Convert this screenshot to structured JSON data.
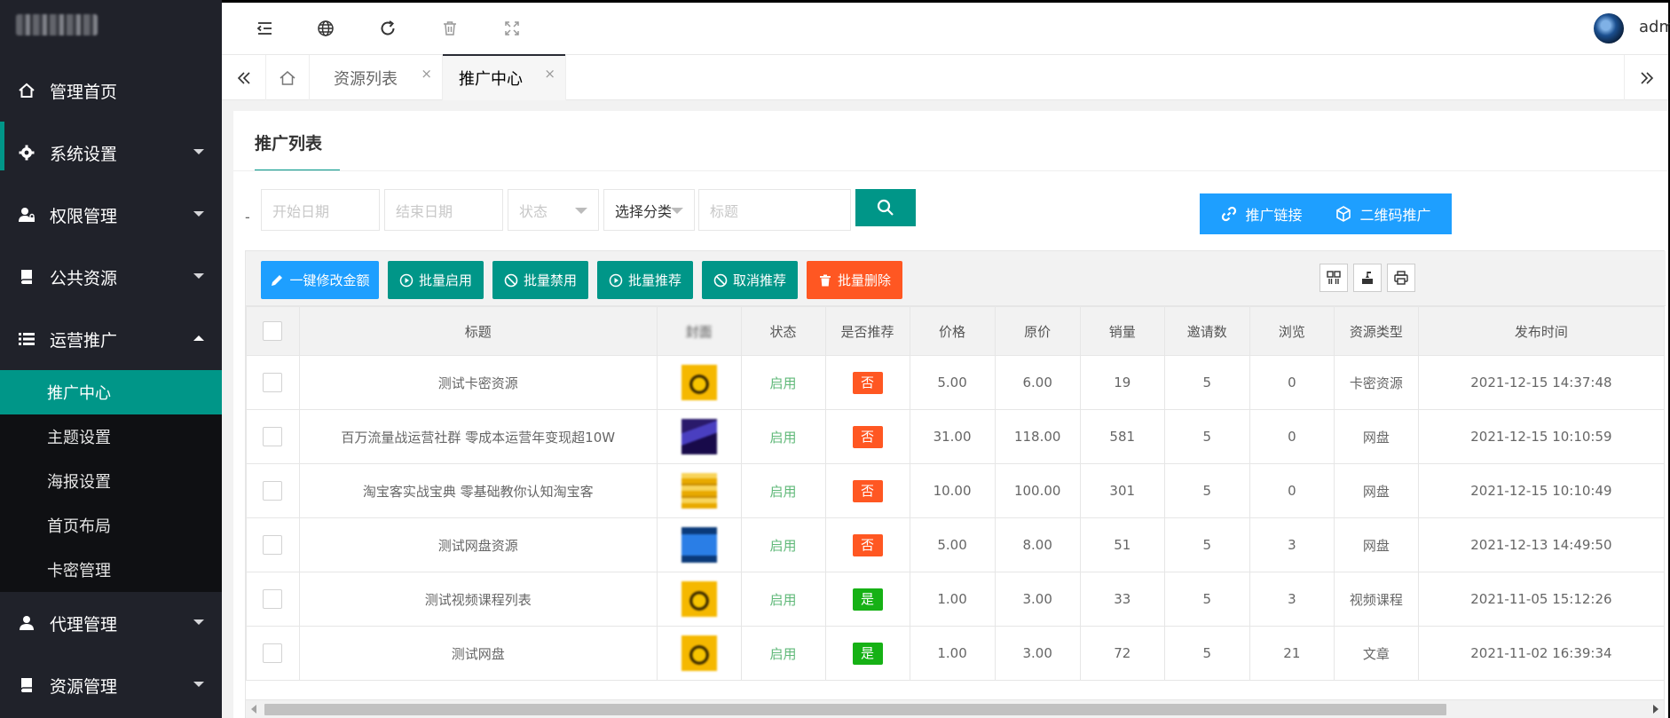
{
  "sidebar": {
    "menu": [
      {
        "label": "管理首页",
        "icon": "home-icon",
        "caret": "none"
      },
      {
        "label": "系统设置",
        "icon": "gear-icon",
        "caret": "down"
      },
      {
        "label": "权限管理",
        "icon": "user-lock-icon",
        "caret": "down"
      },
      {
        "label": "公共资源",
        "icon": "book-icon",
        "caret": "down"
      },
      {
        "label": "运营推广",
        "icon": "list-icon",
        "caret": "up"
      }
    ],
    "sub_items": [
      "推广中心",
      "主题设置",
      "海报设置",
      "首页布局",
      "卡密管理"
    ],
    "menu_after": [
      {
        "label": "代理管理",
        "icon": "user-icon",
        "caret": "down"
      },
      {
        "label": "资源管理",
        "icon": "book-icon",
        "caret": "down"
      }
    ]
  },
  "header": {
    "tools": [
      "menu-fold-icon",
      "globe-icon",
      "refresh-icon",
      "trash-icon",
      "fullscreen-icon"
    ],
    "user_name": "adm"
  },
  "tabs": {
    "items": [
      {
        "label": "资源列表",
        "close": "×"
      },
      {
        "label": "推广中心",
        "close": "×"
      }
    ]
  },
  "panel": {
    "title": "推广列表",
    "filters": {
      "dash": "-",
      "start_date": "开始日期",
      "end_date": "结束日期",
      "status": "状态",
      "category": "选择分类",
      "title": "标题"
    },
    "promo_link": "推广链接",
    "qr_promo": "二维码推广"
  },
  "actions": {
    "edit_amount": "一键修改金额",
    "batch_enable": "批量启用",
    "batch_disable": "批量禁用",
    "batch_recommend": "批量推荐",
    "cancel_recommend": "取消推荐",
    "batch_delete": "批量删除"
  },
  "table": {
    "columns": [
      "标题",
      "封面",
      "状态",
      "是否推荐",
      "价格",
      "原价",
      "销量",
      "邀请数",
      "浏览",
      "资源类型",
      "发布时间"
    ],
    "rows": [
      {
        "title": "测试卡密资源",
        "cover": "c-yellow",
        "status": "启用",
        "recommend": "否",
        "price": "5.00",
        "original": "6.00",
        "sales": "19",
        "invites": "5",
        "views": "0",
        "type": "卡密资源",
        "time": "2021-12-15 14:37:48"
      },
      {
        "title": "百万流量战运营社群 零成本运营年变现超10W",
        "cover": "c-purple",
        "status": "启用",
        "recommend": "否",
        "price": "31.00",
        "original": "118.00",
        "sales": "581",
        "invites": "5",
        "views": "0",
        "type": "网盘",
        "time": "2021-12-15 10:10:59"
      },
      {
        "title": "淘宝客实战宝典 零基础教你认知淘宝客",
        "cover": "c-gold",
        "status": "启用",
        "recommend": "否",
        "price": "10.00",
        "original": "100.00",
        "sales": "301",
        "invites": "5",
        "views": "0",
        "type": "网盘",
        "time": "2021-12-15 10:10:49"
      },
      {
        "title": "测试网盘资源",
        "cover": "c-blue",
        "status": "启用",
        "recommend": "否",
        "price": "5.00",
        "original": "8.00",
        "sales": "51",
        "invites": "5",
        "views": "3",
        "type": "网盘",
        "time": "2021-12-13 14:49:50"
      },
      {
        "title": "测试视频课程列表",
        "cover": "c-yellow",
        "status": "启用",
        "recommend": "是",
        "price": "1.00",
        "original": "3.00",
        "sales": "33",
        "invites": "5",
        "views": "3",
        "type": "视频课程",
        "time": "2021-11-05 15:12:26"
      },
      {
        "title": "测试网盘",
        "cover": "c-yellow",
        "status": "启用",
        "recommend": "是",
        "price": "1.00",
        "original": "3.00",
        "sales": "72",
        "invites": "5",
        "views": "21",
        "type": "文章",
        "time": "2021-11-02 16:39:34"
      }
    ]
  },
  "colors": {
    "accent": "#009688",
    "blue": "#1e9fff",
    "danger": "#ff5722",
    "success": "#16b115"
  }
}
